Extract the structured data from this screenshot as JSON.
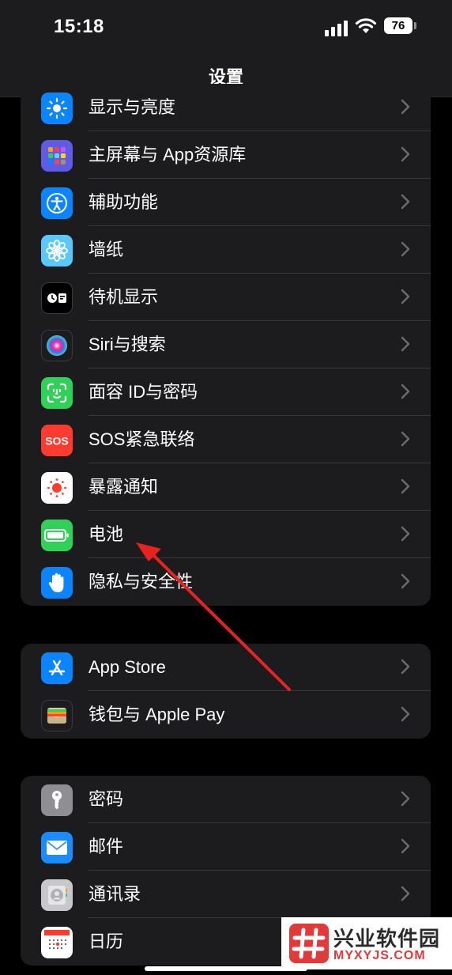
{
  "status_bar": {
    "time": "15:18",
    "battery": "76"
  },
  "nav": {
    "title": "设置"
  },
  "groups": [
    {
      "items": [
        {
          "label": "显示与亮度",
          "icon": "sun-icon",
          "color": "#0a84ff"
        },
        {
          "label": "主屏幕与 App资源库",
          "icon": "app-grid-icon",
          "color": "#5e5ce6"
        },
        {
          "label": "辅助功能",
          "icon": "accessibility-icon",
          "color": "#0a84ff"
        },
        {
          "label": "墙纸",
          "icon": "flower-icon",
          "color": "#5ac8fa"
        },
        {
          "label": "待机显示",
          "icon": "standby-icon",
          "color": "#000000"
        },
        {
          "label": "Siri与搜索",
          "icon": "siri-icon",
          "color": "#1c1c1e"
        },
        {
          "label": "面容 ID与密码",
          "icon": "face-id-icon",
          "color": "#30d158"
        },
        {
          "label": "SOS紧急联络",
          "icon": "sos-icon",
          "color": "#ff3b30"
        },
        {
          "label": "暴露通知",
          "icon": "exposure-icon",
          "color": "#ffffff"
        },
        {
          "label": "电池",
          "icon": "battery-icon",
          "color": "#30d158"
        },
        {
          "label": "隐私与安全性",
          "icon": "hand-icon",
          "color": "#0a84ff"
        }
      ]
    },
    {
      "items": [
        {
          "label": "App Store",
          "icon": "app-store-icon",
          "color": "#0a84ff"
        },
        {
          "label": "钱包与 Apple Pay",
          "icon": "wallet-icon",
          "color": "#1c1c1e"
        }
      ]
    },
    {
      "items": [
        {
          "label": "密码",
          "icon": "key-icon",
          "color": "#8e8e93"
        },
        {
          "label": "邮件",
          "icon": "mail-icon",
          "color": "#1a8cff"
        },
        {
          "label": "通讯录",
          "icon": "contacts-icon",
          "color": "#c7c7cc"
        },
        {
          "label": "日历",
          "icon": "calendar-icon",
          "color": "#ffffff"
        }
      ]
    }
  ],
  "watermark": {
    "name": "兴业软件园",
    "url": "MYXYJS.COM"
  }
}
